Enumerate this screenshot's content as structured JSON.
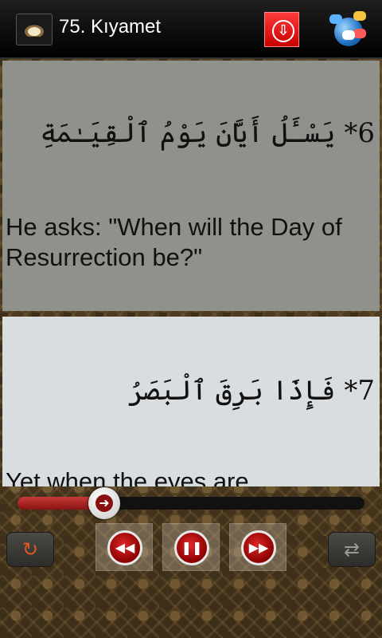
{
  "app": {
    "title": "75. Kıyamet"
  },
  "icons": {
    "app": "open-book-icon",
    "download": "download-icon",
    "share": "chat-globe-icon",
    "repeat": "repeat-icon",
    "rewind": "rewind-icon",
    "pause": "pause-icon",
    "forward": "fast-forward-icon",
    "shuffle": "shuffle-icon",
    "progress_arrow": "arrow-right-icon"
  },
  "verses": [
    {
      "arabic": "6* يَسْـَٔلُ أَيَّانَ يَوْمُ ٱلْقِيَـٰمَةِ",
      "translation": "He asks: \"When will the Day of Resurrection be?\""
    },
    {
      "arabic": "7* فَإِذَا بَرِقَ ٱلْبَصَرُ",
      "translation": "Yet when the eyes are"
    }
  ],
  "player": {
    "progress": 0.25
  },
  "colors": {
    "accent": "#c80000",
    "card_primary": "#8f928b",
    "card_secondary": "#d9dde0"
  }
}
